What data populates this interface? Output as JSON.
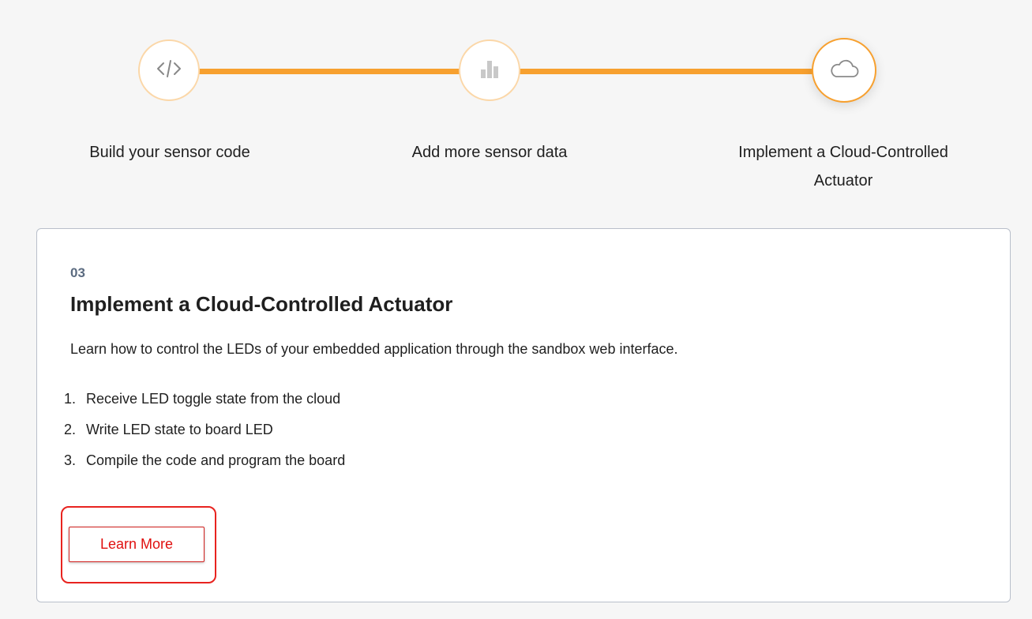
{
  "stepper": {
    "steps": [
      {
        "label": "Build your sensor code",
        "icon": "code-icon"
      },
      {
        "label": "Add more sensor data",
        "icon": "bar-chart-icon"
      },
      {
        "label": "Implement a Cloud-Controlled Actuator",
        "icon": "cloud-icon",
        "active": true
      }
    ],
    "colors": {
      "line": "#f7a02f",
      "circle_border": "#fbd7a8",
      "active_border": "#f7a02f"
    }
  },
  "card": {
    "step_number": "03",
    "title": "Implement a Cloud-Controlled Actuator",
    "description": "Learn how to control the LEDs of your embedded application through the sandbox web interface.",
    "tasks": [
      {
        "num": "1.",
        "text": "Receive LED toggle state from the cloud"
      },
      {
        "num": "2.",
        "text": "Write LED state to board LED"
      },
      {
        "num": "3.",
        "text": "Compile the code and program the board"
      }
    ],
    "button_label": "Learn More",
    "colors": {
      "button_text": "#e0100f",
      "highlight": "#e8231f"
    }
  }
}
